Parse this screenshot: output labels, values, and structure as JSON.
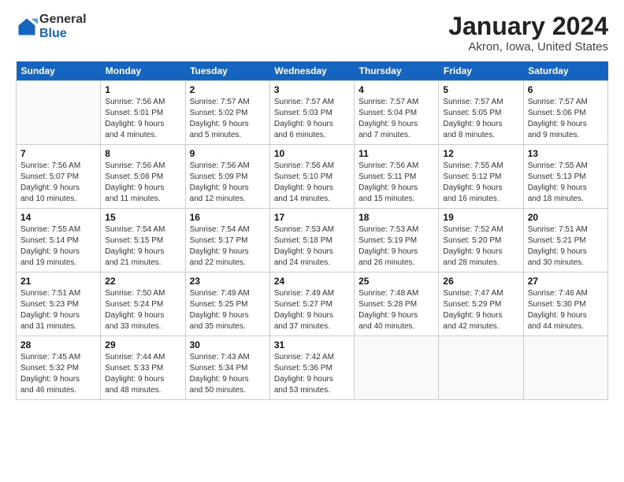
{
  "logo": {
    "general": "General",
    "blue": "Blue"
  },
  "title": "January 2024",
  "subtitle": "Akron, Iowa, United States",
  "headers": [
    "Sunday",
    "Monday",
    "Tuesday",
    "Wednesday",
    "Thursday",
    "Friday",
    "Saturday"
  ],
  "weeks": [
    [
      {
        "day": "",
        "info": ""
      },
      {
        "day": "1",
        "info": "Sunrise: 7:56 AM\nSunset: 5:01 PM\nDaylight: 9 hours\nand 4 minutes."
      },
      {
        "day": "2",
        "info": "Sunrise: 7:57 AM\nSunset: 5:02 PM\nDaylight: 9 hours\nand 5 minutes."
      },
      {
        "day": "3",
        "info": "Sunrise: 7:57 AM\nSunset: 5:03 PM\nDaylight: 9 hours\nand 6 minutes."
      },
      {
        "day": "4",
        "info": "Sunrise: 7:57 AM\nSunset: 5:04 PM\nDaylight: 9 hours\nand 7 minutes."
      },
      {
        "day": "5",
        "info": "Sunrise: 7:57 AM\nSunset: 5:05 PM\nDaylight: 9 hours\nand 8 minutes."
      },
      {
        "day": "6",
        "info": "Sunrise: 7:57 AM\nSunset: 5:06 PM\nDaylight: 9 hours\nand 9 minutes."
      }
    ],
    [
      {
        "day": "7",
        "info": "Sunrise: 7:56 AM\nSunset: 5:07 PM\nDaylight: 9 hours\nand 10 minutes."
      },
      {
        "day": "8",
        "info": "Sunrise: 7:56 AM\nSunset: 5:08 PM\nDaylight: 9 hours\nand 11 minutes."
      },
      {
        "day": "9",
        "info": "Sunrise: 7:56 AM\nSunset: 5:09 PM\nDaylight: 9 hours\nand 12 minutes."
      },
      {
        "day": "10",
        "info": "Sunrise: 7:56 AM\nSunset: 5:10 PM\nDaylight: 9 hours\nand 14 minutes."
      },
      {
        "day": "11",
        "info": "Sunrise: 7:56 AM\nSunset: 5:11 PM\nDaylight: 9 hours\nand 15 minutes."
      },
      {
        "day": "12",
        "info": "Sunrise: 7:55 AM\nSunset: 5:12 PM\nDaylight: 9 hours\nand 16 minutes."
      },
      {
        "day": "13",
        "info": "Sunrise: 7:55 AM\nSunset: 5:13 PM\nDaylight: 9 hours\nand 18 minutes."
      }
    ],
    [
      {
        "day": "14",
        "info": "Sunrise: 7:55 AM\nSunset: 5:14 PM\nDaylight: 9 hours\nand 19 minutes."
      },
      {
        "day": "15",
        "info": "Sunrise: 7:54 AM\nSunset: 5:15 PM\nDaylight: 9 hours\nand 21 minutes."
      },
      {
        "day": "16",
        "info": "Sunrise: 7:54 AM\nSunset: 5:17 PM\nDaylight: 9 hours\nand 22 minutes."
      },
      {
        "day": "17",
        "info": "Sunrise: 7:53 AM\nSunset: 5:18 PM\nDaylight: 9 hours\nand 24 minutes."
      },
      {
        "day": "18",
        "info": "Sunrise: 7:53 AM\nSunset: 5:19 PM\nDaylight: 9 hours\nand 26 minutes."
      },
      {
        "day": "19",
        "info": "Sunrise: 7:52 AM\nSunset: 5:20 PM\nDaylight: 9 hours\nand 28 minutes."
      },
      {
        "day": "20",
        "info": "Sunrise: 7:51 AM\nSunset: 5:21 PM\nDaylight: 9 hours\nand 30 minutes."
      }
    ],
    [
      {
        "day": "21",
        "info": "Sunrise: 7:51 AM\nSunset: 5:23 PM\nDaylight: 9 hours\nand 31 minutes."
      },
      {
        "day": "22",
        "info": "Sunrise: 7:50 AM\nSunset: 5:24 PM\nDaylight: 9 hours\nand 33 minutes."
      },
      {
        "day": "23",
        "info": "Sunrise: 7:49 AM\nSunset: 5:25 PM\nDaylight: 9 hours\nand 35 minutes."
      },
      {
        "day": "24",
        "info": "Sunrise: 7:49 AM\nSunset: 5:27 PM\nDaylight: 9 hours\nand 37 minutes."
      },
      {
        "day": "25",
        "info": "Sunrise: 7:48 AM\nSunset: 5:28 PM\nDaylight: 9 hours\nand 40 minutes."
      },
      {
        "day": "26",
        "info": "Sunrise: 7:47 AM\nSunset: 5:29 PM\nDaylight: 9 hours\nand 42 minutes."
      },
      {
        "day": "27",
        "info": "Sunrise: 7:46 AM\nSunset: 5:30 PM\nDaylight: 9 hours\nand 44 minutes."
      }
    ],
    [
      {
        "day": "28",
        "info": "Sunrise: 7:45 AM\nSunset: 5:32 PM\nDaylight: 9 hours\nand 46 minutes."
      },
      {
        "day": "29",
        "info": "Sunrise: 7:44 AM\nSunset: 5:33 PM\nDaylight: 9 hours\nand 48 minutes."
      },
      {
        "day": "30",
        "info": "Sunrise: 7:43 AM\nSunset: 5:34 PM\nDaylight: 9 hours\nand 50 minutes."
      },
      {
        "day": "31",
        "info": "Sunrise: 7:42 AM\nSunset: 5:36 PM\nDaylight: 9 hours\nand 53 minutes."
      },
      {
        "day": "",
        "info": ""
      },
      {
        "day": "",
        "info": ""
      },
      {
        "day": "",
        "info": ""
      }
    ]
  ]
}
